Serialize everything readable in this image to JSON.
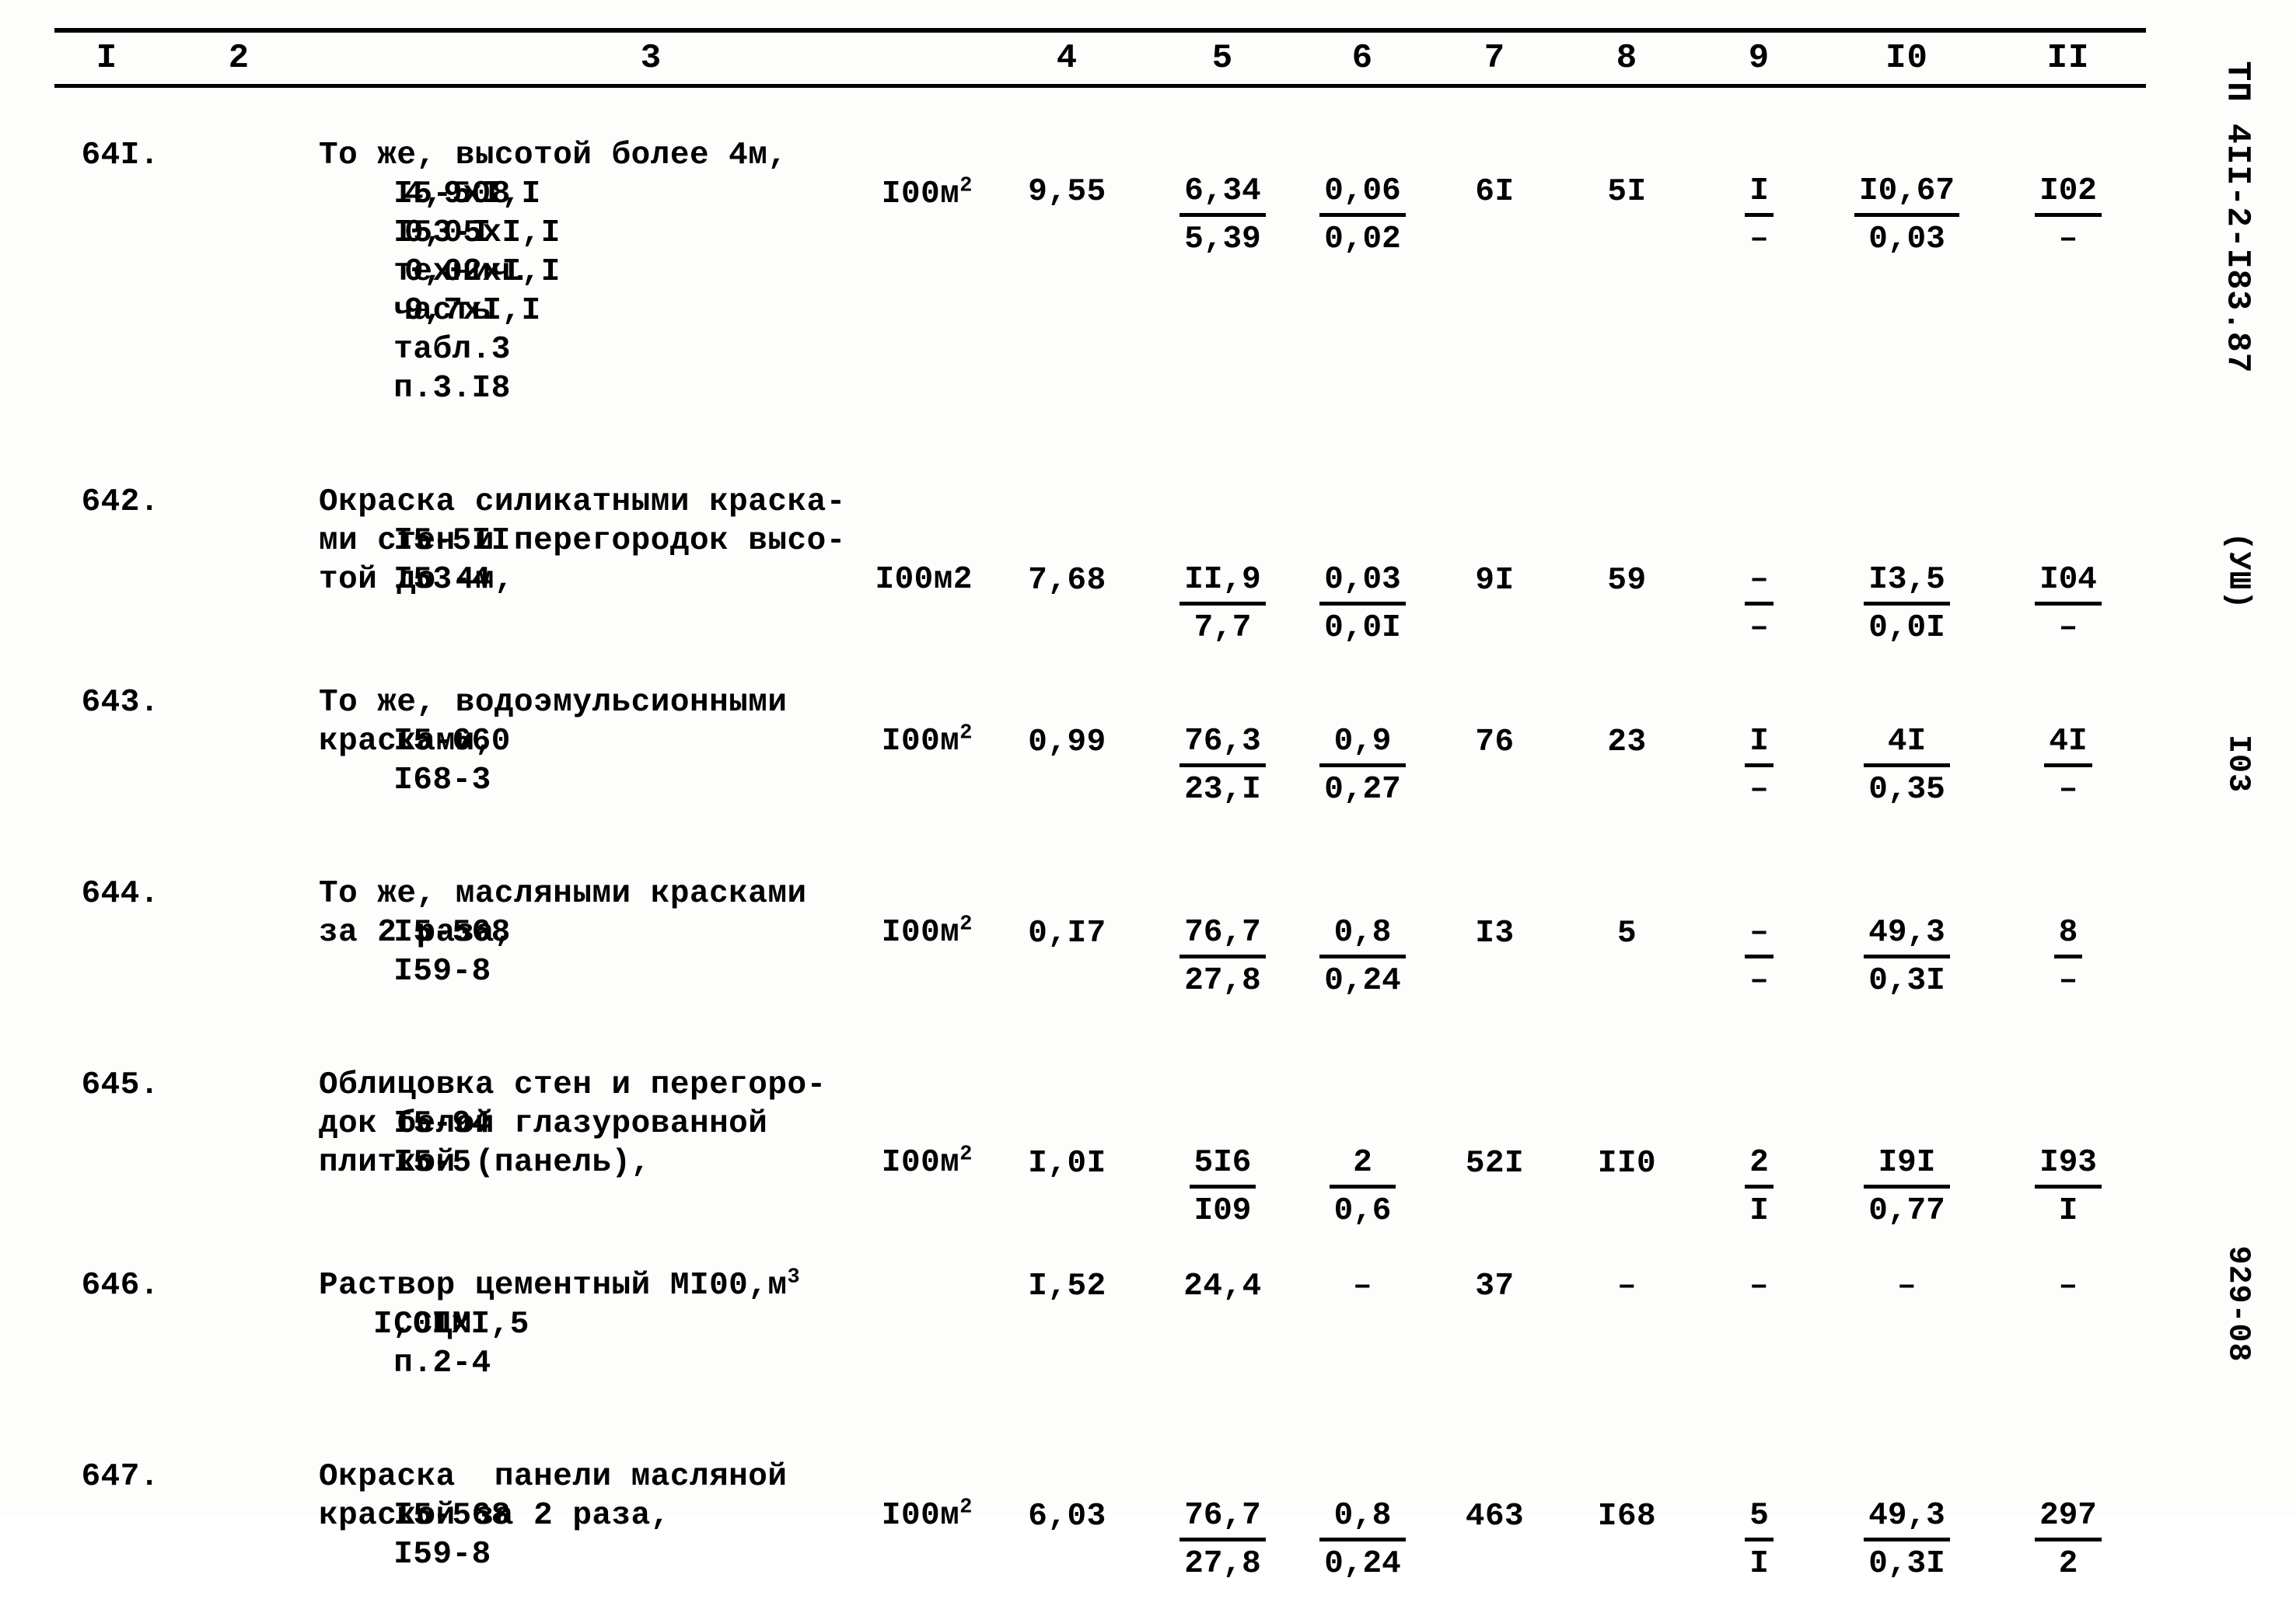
{
  "margin": {
    "doc_code": "ТП 4II-2-I83.87",
    "section": "(УШ)",
    "page_number": "I03",
    "bottom_code": "929-08"
  },
  "table": {
    "column_headers": [
      "I",
      "2",
      "3",
      "4",
      "5",
      "6",
      "7",
      "8",
      "9",
      "I0",
      "II"
    ],
    "rows": [
      {
        "index": "64I.",
        "code_lines": [
          "I5-508",
          "I53-I",
          "технич.",
          "часть",
          "табл.3",
          "п.3.I8"
        ],
        "desc_lines": [
          "То же, высотой более 4м,"
        ],
        "unit": "I00м",
        "unit_sup": "2",
        "extra_lines": [
          "4,9хI,I",
          "0,05хI,I",
          "0,02хI,I",
          "9,7хI,I"
        ],
        "c4": "9,55",
        "c5": {
          "top": "6,34",
          "bot": "5,39"
        },
        "c6": {
          "top": "0,06",
          "bot": "0,02"
        },
        "c7": "6I",
        "c8": "5I",
        "c9": {
          "top": "I",
          "bot": "–"
        },
        "c10": {
          "top": "I0,67",
          "bot": "0,03"
        },
        "c11": {
          "top": "I02",
          "bot": "–"
        }
      },
      {
        "index": "642.",
        "code_lines": [
          "I5-5II",
          "I53-4"
        ],
        "desc_lines": [
          "Окраска силикатными краска-",
          "ми стен и перегородок высо-",
          "той до 4м,"
        ],
        "unit": "I00м2",
        "unit_sup": "",
        "extra_lines": [],
        "c4": "7,68",
        "c5": {
          "top": "II,9",
          "bot": "7,7"
        },
        "c6": {
          "top": "0,03",
          "bot": "0,0I"
        },
        "c7": "9I",
        "c8": "59",
        "c9": {
          "top": "–",
          "bot": "–"
        },
        "c10": {
          "top": "I3,5",
          "bot": "0,0I"
        },
        "c11": {
          "top": "I04",
          "bot": "–"
        }
      },
      {
        "index": "643.",
        "code_lines": [
          "I5-660",
          "I68-3"
        ],
        "desc_lines": [
          "То же, водоэмульсионными",
          "красками,"
        ],
        "unit": "I00м",
        "unit_sup": "2",
        "extra_lines": [],
        "c4": "0,99",
        "c5": {
          "top": "76,3",
          "bot": "23,I"
        },
        "c6": {
          "top": "0,9",
          "bot": "0,27"
        },
        "c7": "76",
        "c8": "23",
        "c9": {
          "top": "I",
          "bot": "–"
        },
        "c10": {
          "top": "4I",
          "bot": "0,35"
        },
        "c11": {
          "top": "4I",
          "bot": "–"
        }
      },
      {
        "index": "644.",
        "code_lines": [
          "I5-568",
          "I59-8"
        ],
        "desc_lines": [
          "То же, масляными красками",
          "за 2 раза,"
        ],
        "unit": "I00м",
        "unit_sup": "2",
        "extra_lines": [],
        "c4": "0,I7",
        "c5": {
          "top": "76,7",
          "bot": "27,8"
        },
        "c6": {
          "top": "0,8",
          "bot": "0,24"
        },
        "c7": "I3",
        "c8": "5",
        "c9": {
          "top": "–",
          "bot": "–"
        },
        "c10": {
          "top": "49,3",
          "bot": "0,3I"
        },
        "c11": {
          "top": "8",
          "bot": "–"
        }
      },
      {
        "index": "645.",
        "code_lines": [
          "I5-94",
          "I5-5"
        ],
        "desc_lines": [
          "Облицовка стен и перегоро-",
          "док белой глазурованной",
          "плиткой (панель),"
        ],
        "unit": "I00м",
        "unit_sup": "2",
        "extra_lines": [],
        "c4": "I,0I",
        "c5": {
          "top": "5I6",
          "bot": "I09"
        },
        "c6": {
          "top": "2",
          "bot": "0,6"
        },
        "c7": "52I",
        "c8": "II0",
        "c9": {
          "top": "2",
          "bot": "I"
        },
        "c10": {
          "top": "I9I",
          "bot": "0,77"
        },
        "c11": {
          "top": "I93",
          "bot": "I"
        }
      },
      {
        "index": "646.",
        "code_lines": [
          "ССЦМ",
          "п.2-4"
        ],
        "desc_lines": [
          "Раствор цементный MI00,м"
        ],
        "unit": "",
        "unit_sup": "3",
        "extra_lines": [
          "I,0IхI,5"
        ],
        "c4": "I,52",
        "c5": {
          "top": "24,4",
          "bot": ""
        },
        "c6": {
          "top": "–",
          "bot": ""
        },
        "c7": "37",
        "c8": "–",
        "c9": {
          "top": "–",
          "bot": ""
        },
        "c10": {
          "top": "–",
          "bot": ""
        },
        "c11": {
          "top": "–",
          "bot": ""
        }
      },
      {
        "index": "647.",
        "code_lines": [
          "I5-568",
          "I59-8"
        ],
        "desc_lines": [
          "Окраска  панели масляной",
          "краской за 2 раза,"
        ],
        "unit": "I00м",
        "unit_sup": "2",
        "extra_lines": [],
        "c4": "6,03",
        "c5": {
          "top": "76,7",
          "bot": "27,8"
        },
        "c6": {
          "top": "0,8",
          "bot": "0,24"
        },
        "c7": "463",
        "c8": "I68",
        "c9": {
          "top": "5",
          "bot": "I"
        },
        "c10": {
          "top": "49,3",
          "bot": "0,3I"
        },
        "c11": {
          "top": "297",
          "bot": "2"
        }
      }
    ]
  }
}
